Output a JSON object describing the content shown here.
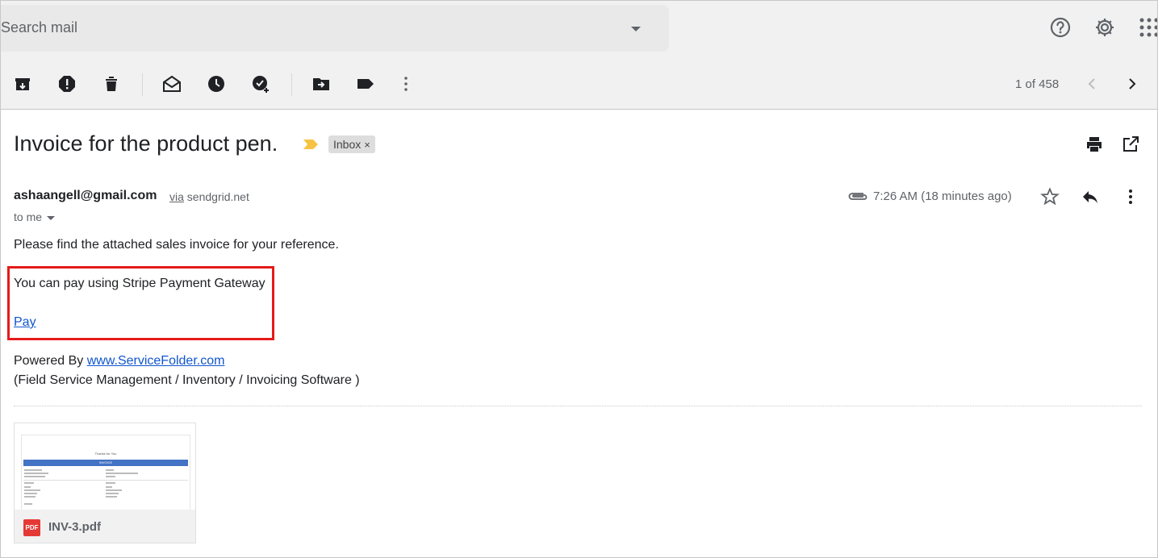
{
  "search": {
    "placeholder": "Search mail",
    "display_text": "Search mail"
  },
  "toolbar": {
    "icons": [
      "archive-icon",
      "report-spam-icon",
      "delete-icon",
      "mark-unread-icon",
      "snooze-icon",
      "add-task-icon",
      "move-to-icon",
      "label-icon",
      "more-icon"
    ],
    "pager": "1 of 458"
  },
  "message": {
    "subject": "Invoice for the product pen.",
    "label": "Inbox",
    "label_remove": "×",
    "sender_email": "ashaangell@gmail.com",
    "via_word": "via",
    "via_domain": "sendgrid.net",
    "recipient": "to me",
    "time": "7:26 AM (18 minutes ago)",
    "colors": {
      "important_marker": "#f6c344",
      "highlight_box": "#e51a1a",
      "link": "#1155cc"
    }
  },
  "body": {
    "intro": "Please find the attached sales invoice for your reference.",
    "pay_text": "You can pay using Stripe Payment Gateway",
    "pay_link": "Pay",
    "powered_by": "Powered By ",
    "powered_link": "www.ServiceFolder.com",
    "tagline": "(Field Service Management / Inventory / Invoicing Software )"
  },
  "attachment": {
    "filename": "INV-3.pdf",
    "badge": "PDF",
    "preview_heading": "Thanks for You",
    "preview_band": "INVOICE"
  }
}
